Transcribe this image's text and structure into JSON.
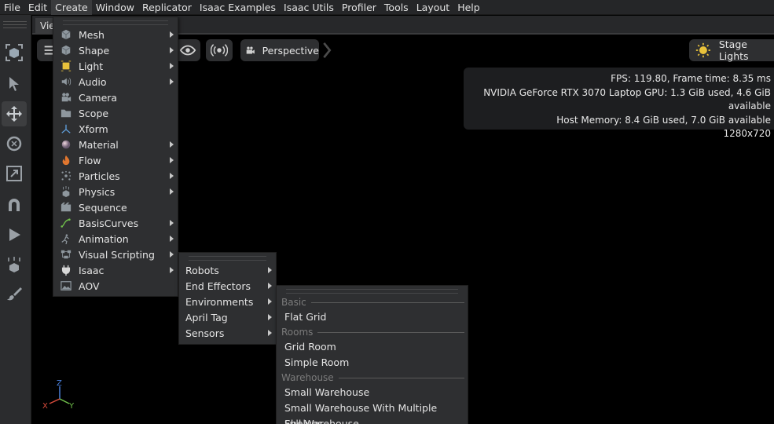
{
  "menubar": [
    "File",
    "Edit",
    "Create",
    "Window",
    "Replicator",
    "Isaac Examples",
    "Isaac Utils",
    "Profiler",
    "Tools",
    "Layout",
    "Help"
  ],
  "viewport": {
    "tab_label": "Vie",
    "camera_label": "Perspective",
    "lights_label": "Stage Lights",
    "stats": [
      "FPS: 119.80, Frame time: 8.35 ms",
      "NVIDIA GeForce RTX 3070 Laptop GPU: 1.3 GiB used, 4.6 GiB available",
      "Host Memory: 8.4 GiB used, 7.0 GiB available",
      "1280x720"
    ],
    "axis": {
      "x": "X",
      "y": "Y",
      "z": "Z"
    }
  },
  "create_menu": [
    {
      "label": "Mesh",
      "icon": "cube-icon",
      "submenu": true
    },
    {
      "label": "Shape",
      "icon": "cube-icon",
      "submenu": true
    },
    {
      "label": "Light",
      "icon": "light-icon",
      "submenu": true
    },
    {
      "label": "Audio",
      "icon": "audio-icon",
      "submenu": true
    },
    {
      "label": "Camera",
      "icon": "camera-icon",
      "submenu": false
    },
    {
      "label": "Scope",
      "icon": "folder-icon",
      "submenu": false
    },
    {
      "label": "Xform",
      "icon": "xform-icon",
      "submenu": false
    },
    {
      "label": "Material",
      "icon": "material-sphere-icon",
      "submenu": true
    },
    {
      "label": "Flow",
      "icon": "flame-icon",
      "submenu": true
    },
    {
      "label": "Particles",
      "icon": "particles-icon",
      "submenu": true
    },
    {
      "label": "Physics",
      "icon": "physics-icon",
      "submenu": true
    },
    {
      "label": "Sequence",
      "icon": "sequence-icon",
      "submenu": false
    },
    {
      "label": "BasisCurves",
      "icon": "curve-icon",
      "submenu": true
    },
    {
      "label": "Animation",
      "icon": "animation-icon",
      "submenu": true
    },
    {
      "label": "Visual Scripting",
      "icon": "graph-icon",
      "submenu": true
    },
    {
      "label": "Isaac",
      "icon": "plug-icon",
      "submenu": true
    },
    {
      "label": "AOV",
      "icon": "image-icon",
      "submenu": false
    }
  ],
  "isaac_menu": [
    {
      "label": "Robots"
    },
    {
      "label": "End Effectors"
    },
    {
      "label": "Environments"
    },
    {
      "label": "April Tag"
    },
    {
      "label": "Sensors"
    }
  ],
  "environments_menu": {
    "sections": [
      {
        "title": "Basic",
        "items": [
          "Flat Grid"
        ]
      },
      {
        "title": "Rooms",
        "items": [
          "Grid Room",
          "Simple Room"
        ]
      },
      {
        "title": "Warehouse",
        "items": [
          "Small Warehouse",
          "Small Warehouse With Multiple Shelves",
          "Full Warehouse"
        ]
      }
    ]
  },
  "colors": {
    "accent_yellow": "#e9c23b",
    "axis_x": "#d94b3c",
    "axis_y": "#6fbf4a",
    "axis_z": "#4a7fd9"
  }
}
